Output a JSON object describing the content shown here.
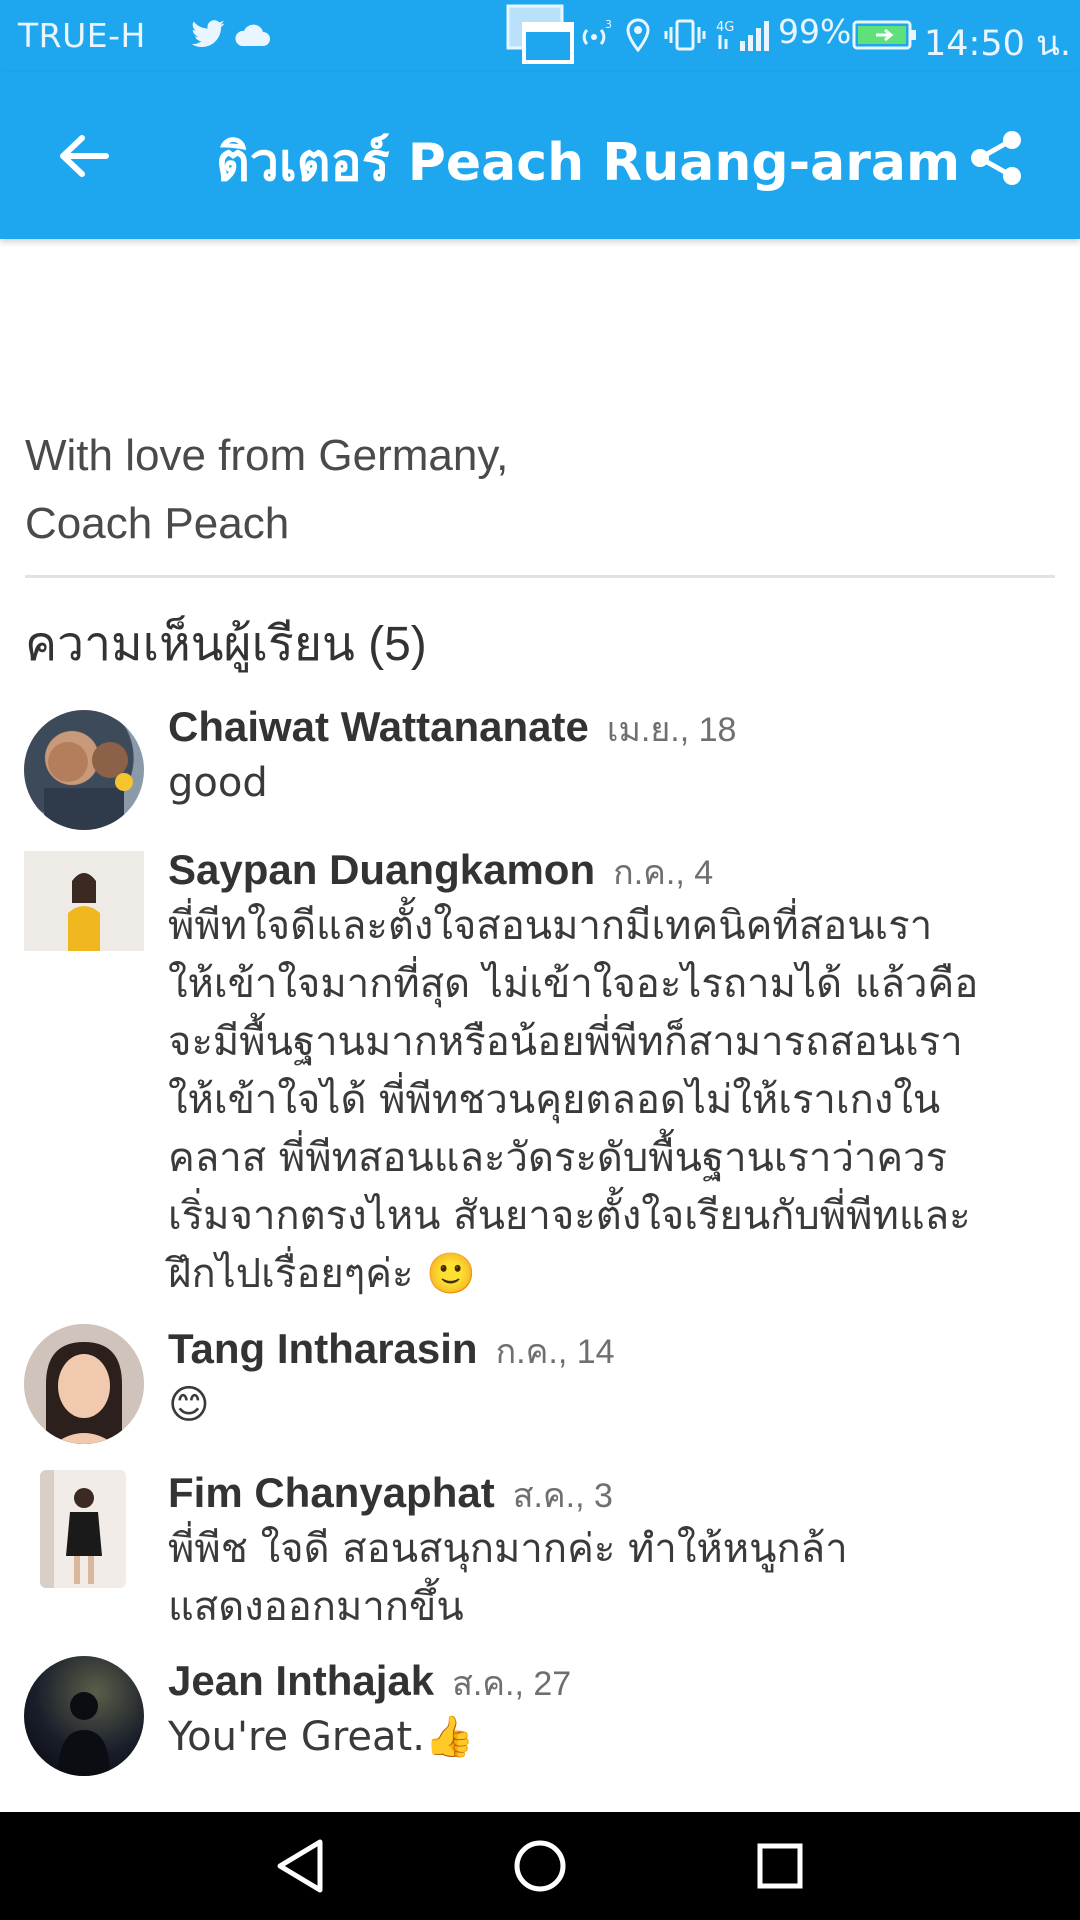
{
  "status_bar": {
    "carrier": "TRUE-H",
    "battery_percent": "99%",
    "clock": "14:50 น.",
    "icons": [
      "twitter-icon",
      "cloud-icon",
      "screen-mirror-icon",
      "hotspot-icon",
      "location-icon",
      "vibrate-icon",
      "signal-4g-icon",
      "battery-charging-icon"
    ]
  },
  "app_bar": {
    "title": "ติวเตอร์ Peach Ruang-aram",
    "back_icon": "arrow-back-icon",
    "share_icon": "share-icon"
  },
  "content": {
    "intro_lines": [
      "With love from Germany,",
      "Coach Peach"
    ],
    "section_title": "ความเห็นผู้เรียน (5)"
  },
  "comments": [
    {
      "name": "Chaiwat Wattananate",
      "date": "เม.ย., 18",
      "lines": [
        "good"
      ]
    },
    {
      "name": "Saypan Duangkamon",
      "date": "ก.ค., 4",
      "lines": [
        "พี่พีทใจดีและตั้งใจสอนมากมีเทคนิคที่สอนเรา",
        "ให้เข้าใจมากที่สุด ไม่เข้าใจอะไรถามได้ แล้วคือ",
        "จะมีพื้นฐานมากหรือน้อยพี่พีทก็สามารถสอนเรา",
        "ให้เข้าใจได้ พี่พีทชวนคุยตลอดไม่ให้เราเกงใน",
        "คลาส พี่พีทสอนและวัดระดับพื้นฐานเราว่าควร",
        "เริ่มจากตรงไหน สันยาจะตั้งใจเรียนกับพี่พีทและ",
        "ฝึกไปเรื่อยๆค่ะ 🙂"
      ]
    },
    {
      "name": "Tang Intharasin",
      "date": "ก.ค., 14",
      "lines": [
        "😊"
      ]
    },
    {
      "name": "Fim Chanyaphat",
      "date": "ส.ค., 3",
      "lines": [
        "พี่พีช ใจดี สอนสนุกมากค่ะ ทำให้หนูกล้า",
        "แสดงออกมากขึ้น"
      ]
    },
    {
      "name": "Jean Inthajak",
      "date": "ส.ค., 27",
      "lines": [
        "You're Great.👍"
      ]
    }
  ],
  "nav_bar": {
    "icons": [
      "back-triangle-icon",
      "home-circle-icon",
      "recents-square-icon"
    ]
  },
  "colors": {
    "primary": "#1ea7ee",
    "text": "#333333",
    "muted": "#6f6f6f",
    "divider": "#e2e2e2"
  }
}
